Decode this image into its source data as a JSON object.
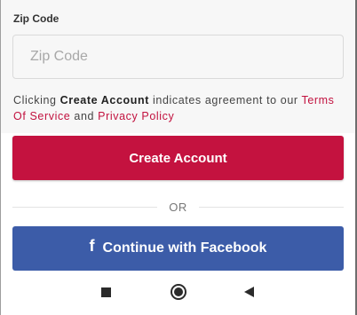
{
  "form": {
    "zip_label": "Zip Code",
    "zip_placeholder": "Zip Code",
    "zip_value": ""
  },
  "terms": {
    "prefix": "Clicking ",
    "action": "Create Account",
    "middle": " indicates agreement to our ",
    "tos_link": "Terms Of Service",
    "conjunction": " and ",
    "privacy_link": "Privacy Policy"
  },
  "buttons": {
    "create_account": "Create Account",
    "divider": "OR",
    "facebook": "Continue with Facebook",
    "facebook_icon_glyph": "f"
  },
  "colors": {
    "primary": "#c4123f",
    "facebook": "#3c5ca8",
    "link": "#c2123f"
  },
  "navbar": {
    "icons": [
      "recents-icon",
      "home-icon",
      "back-icon"
    ]
  }
}
